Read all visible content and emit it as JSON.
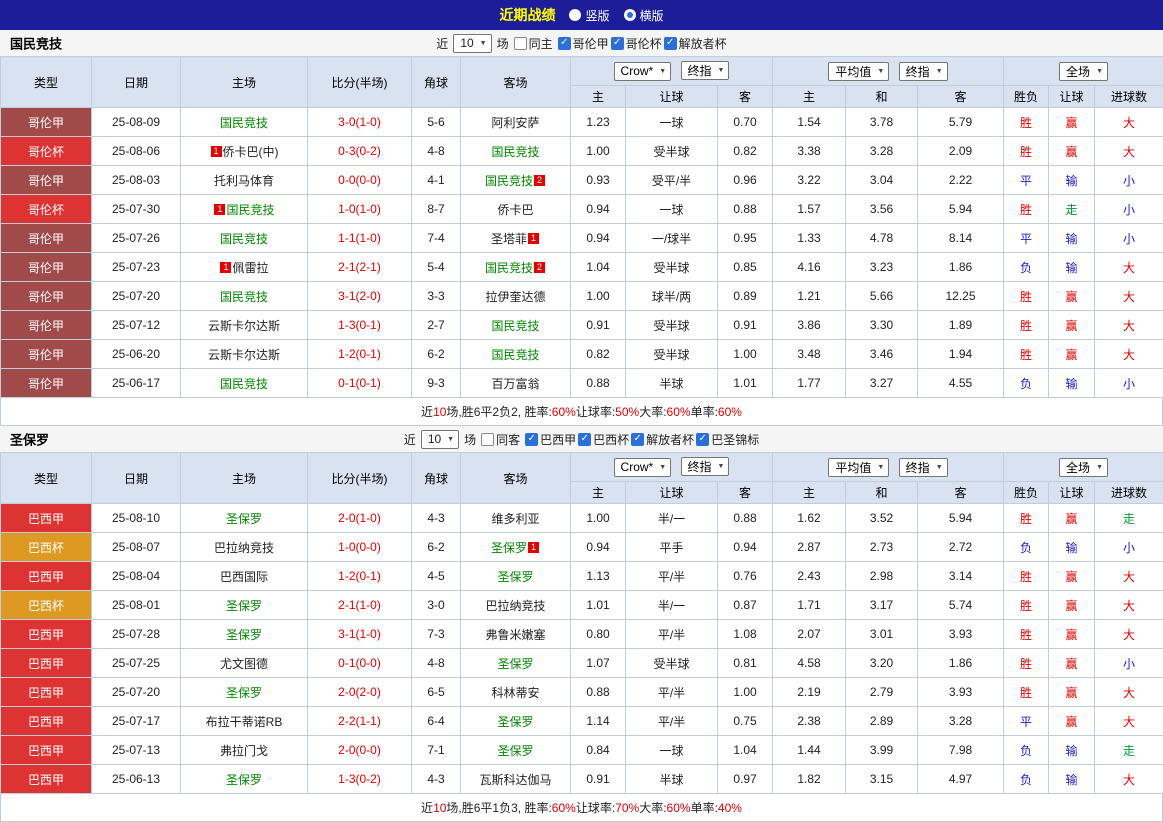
{
  "topbar": {
    "title": "近期战绩",
    "vertical_label": "竖版",
    "horizontal_label": "横版"
  },
  "filter_labels": {
    "near": "近",
    "games": "场"
  },
  "table_labels": {
    "type": "类型",
    "date": "日期",
    "home": "主场",
    "score": "比分(半场)",
    "corner": "角球",
    "away": "客场",
    "bookmaker": "Crow*",
    "final_index": "终指",
    "average": "平均值",
    "full_match": "全场",
    "h_home": "主",
    "h_handicap": "让球",
    "h_away": "客",
    "h_home2": "主",
    "h_draw": "和",
    "h_away2": "客",
    "h_result": "胜负",
    "h_handicap_result": "让球",
    "h_goals": "进球数"
  },
  "league_colors": {
    "哥伦甲": "#a14a4a",
    "哥伦杯": "#dd3333",
    "巴西甲": "#dd3333",
    "巴西杯": "#dd9922"
  },
  "result_colors": {
    "胜": "#e60000",
    "平": "#1a1acd",
    "负": "#1a1acd",
    "赢": "#e60000",
    "输": "#1a1acd",
    "走": "#009933",
    "大": "#e60000",
    "小": "#1a1acd"
  },
  "sections": [
    {
      "team": "国民竞技",
      "filter": {
        "count": "10",
        "same_label": "同主",
        "competitions": [
          "哥伦甲",
          "哥伦杯",
          "解放者杯"
        ]
      },
      "rows": [
        {
          "league": "哥伦甲",
          "date": "25-08-09",
          "home": {
            "text": "国民竞技",
            "self": true
          },
          "score": "3-0(1-0)",
          "corner": "5-6",
          "away": {
            "text": "阿利安萨"
          },
          "asian": [
            "1.23",
            "一球",
            "0.70"
          ],
          "euro": [
            "1.54",
            "3.78",
            "5.79"
          ],
          "results": [
            "胜",
            "赢",
            "大"
          ]
        },
        {
          "league": "哥伦杯",
          "date": "25-08-06",
          "home": {
            "text": "侨卡巴(中)",
            "pre": "1"
          },
          "score": "0-3(0-2)",
          "corner": "4-8",
          "away": {
            "text": "国民竞技",
            "self": true
          },
          "asian": [
            "1.00",
            "受半球",
            "0.82"
          ],
          "euro": [
            "3.38",
            "3.28",
            "2.09"
          ],
          "results": [
            "胜",
            "赢",
            "大"
          ]
        },
        {
          "league": "哥伦甲",
          "date": "25-08-03",
          "home": {
            "text": "托利马体育"
          },
          "score": "0-0(0-0)",
          "corner": "4-1",
          "away": {
            "text": "国民竞技",
            "self": true,
            "post": "2"
          },
          "asian": [
            "0.93",
            "受平/半",
            "0.96"
          ],
          "euro": [
            "3.22",
            "3.04",
            "2.22"
          ],
          "results": [
            "平",
            "输",
            "小"
          ]
        },
        {
          "league": "哥伦杯",
          "date": "25-07-30",
          "home": {
            "text": "国民竞技",
            "self": true,
            "pre": "1"
          },
          "score": "1-0(1-0)",
          "corner": "8-7",
          "away": {
            "text": "侨卡巴"
          },
          "asian": [
            "0.94",
            "一球",
            "0.88"
          ],
          "euro": [
            "1.57",
            "3.56",
            "5.94"
          ],
          "results": [
            "胜",
            "走",
            "小"
          ]
        },
        {
          "league": "哥伦甲",
          "date": "25-07-26",
          "home": {
            "text": "国民竞技",
            "self": true
          },
          "score": "1-1(1-0)",
          "corner": "7-4",
          "away": {
            "text": "圣塔菲",
            "post": "1"
          },
          "asian": [
            "0.94",
            "一/球半",
            "0.95"
          ],
          "euro": [
            "1.33",
            "4.78",
            "8.14"
          ],
          "results": [
            "平",
            "输",
            "小"
          ]
        },
        {
          "league": "哥伦甲",
          "date": "25-07-23",
          "home": {
            "text": "佩雷拉",
            "pre": "1"
          },
          "score": "2-1(2-1)",
          "corner": "5-4",
          "away": {
            "text": "国民竞技",
            "self": true,
            "post": "2"
          },
          "asian": [
            "1.04",
            "受半球",
            "0.85"
          ],
          "euro": [
            "4.16",
            "3.23",
            "1.86"
          ],
          "results": [
            "负",
            "输",
            "大"
          ]
        },
        {
          "league": "哥伦甲",
          "date": "25-07-20",
          "home": {
            "text": "国民竞技",
            "self": true
          },
          "score": "3-1(2-0)",
          "corner": "3-3",
          "away": {
            "text": "拉伊奎达德"
          },
          "asian": [
            "1.00",
            "球半/两",
            "0.89"
          ],
          "euro": [
            "1.21",
            "5.66",
            "12.25"
          ],
          "results": [
            "胜",
            "赢",
            "大"
          ]
        },
        {
          "league": "哥伦甲",
          "date": "25-07-12",
          "home": {
            "text": "云斯卡尔达斯"
          },
          "score": "1-3(0-1)",
          "corner": "2-7",
          "away": {
            "text": "国民竞技",
            "self": true
          },
          "asian": [
            "0.91",
            "受半球",
            "0.91"
          ],
          "euro": [
            "3.86",
            "3.30",
            "1.89"
          ],
          "results": [
            "胜",
            "赢",
            "大"
          ]
        },
        {
          "league": "哥伦甲",
          "date": "25-06-20",
          "home": {
            "text": "云斯卡尔达斯"
          },
          "score": "1-2(0-1)",
          "corner": "6-2",
          "away": {
            "text": "国民竞技",
            "self": true
          },
          "asian": [
            "0.82",
            "受半球",
            "1.00"
          ],
          "euro": [
            "3.48",
            "3.46",
            "1.94"
          ],
          "results": [
            "胜",
            "赢",
            "大"
          ]
        },
        {
          "league": "哥伦甲",
          "date": "25-06-17",
          "home": {
            "text": "国民竞技",
            "self": true
          },
          "score": "0-1(0-1)",
          "corner": "9-3",
          "away": {
            "text": "百万富翁"
          },
          "asian": [
            "0.88",
            "半球",
            "1.01"
          ],
          "euro": [
            "1.77",
            "3.27",
            "4.55"
          ],
          "results": [
            "负",
            "输",
            "小"
          ]
        }
      ],
      "summary": [
        {
          "t": "近"
        },
        {
          "t": "10",
          "red": true
        },
        {
          "t": "场,胜6平2负2, 胜率:"
        },
        {
          "t": "60%",
          "red": true
        },
        {
          "t": " 让球率:"
        },
        {
          "t": "50%",
          "red": true
        },
        {
          "t": " 大率:"
        },
        {
          "t": "60%",
          "red": true
        },
        {
          "t": " 单率:"
        },
        {
          "t": "60%",
          "red": true
        }
      ]
    },
    {
      "team": "圣保罗",
      "filter": {
        "count": "10",
        "same_label": "同客",
        "competitions": [
          "巴西甲",
          "巴西杯",
          "解放者杯",
          "巴圣锦标"
        ]
      },
      "rows": [
        {
          "league": "巴西甲",
          "date": "25-08-10",
          "home": {
            "text": "圣保罗",
            "self": true
          },
          "score": "2-0(1-0)",
          "corner": "4-3",
          "away": {
            "text": "维多利亚"
          },
          "asian": [
            "1.00",
            "半/一",
            "0.88"
          ],
          "euro": [
            "1.62",
            "3.52",
            "5.94"
          ],
          "results": [
            "胜",
            "赢",
            "走"
          ]
        },
        {
          "league": "巴西杯",
          "date": "25-08-07",
          "home": {
            "text": "巴拉纳竞技"
          },
          "score": "1-0(0-0)",
          "corner": "6-2",
          "away": {
            "text": "圣保罗",
            "self": true,
            "post": "1"
          },
          "asian": [
            "0.94",
            "平手",
            "0.94"
          ],
          "euro": [
            "2.87",
            "2.73",
            "2.72"
          ],
          "results": [
            "负",
            "输",
            "小"
          ]
        },
        {
          "league": "巴西甲",
          "date": "25-08-04",
          "home": {
            "text": "巴西国际"
          },
          "score": "1-2(0-1)",
          "corner": "4-5",
          "away": {
            "text": "圣保罗",
            "self": true
          },
          "asian": [
            "1.13",
            "平/半",
            "0.76"
          ],
          "euro": [
            "2.43",
            "2.98",
            "3.14"
          ],
          "results": [
            "胜",
            "赢",
            "大"
          ]
        },
        {
          "league": "巴西杯",
          "date": "25-08-01",
          "home": {
            "text": "圣保罗",
            "self": true
          },
          "score": "2-1(1-0)",
          "corner": "3-0",
          "away": {
            "text": "巴拉纳竞技"
          },
          "asian": [
            "1.01",
            "半/一",
            "0.87"
          ],
          "euro": [
            "1.71",
            "3.17",
            "5.74"
          ],
          "results": [
            "胜",
            "赢",
            "大"
          ]
        },
        {
          "league": "巴西甲",
          "date": "25-07-28",
          "home": {
            "text": "圣保罗",
            "self": true
          },
          "score": "3-1(1-0)",
          "corner": "7-3",
          "away": {
            "text": "弗鲁米嫩塞"
          },
          "asian": [
            "0.80",
            "平/半",
            "1.08"
          ],
          "euro": [
            "2.07",
            "3.01",
            "3.93"
          ],
          "results": [
            "胜",
            "赢",
            "大"
          ]
        },
        {
          "league": "巴西甲",
          "date": "25-07-25",
          "home": {
            "text": "尤文图德"
          },
          "score": "0-1(0-0)",
          "corner": "4-8",
          "away": {
            "text": "圣保罗",
            "self": true
          },
          "asian": [
            "1.07",
            "受半球",
            "0.81"
          ],
          "euro": [
            "4.58",
            "3.20",
            "1.86"
          ],
          "results": [
            "胜",
            "赢",
            "小"
          ]
        },
        {
          "league": "巴西甲",
          "date": "25-07-20",
          "home": {
            "text": "圣保罗",
            "self": true
          },
          "score": "2-0(2-0)",
          "corner": "6-5",
          "away": {
            "text": "科林蒂安"
          },
          "asian": [
            "0.88",
            "平/半",
            "1.00"
          ],
          "euro": [
            "2.19",
            "2.79",
            "3.93"
          ],
          "results": [
            "胜",
            "赢",
            "大"
          ]
        },
        {
          "league": "巴西甲",
          "date": "25-07-17",
          "home": {
            "text": "布拉干蒂诺RB"
          },
          "score": "2-2(1-1)",
          "corner": "6-4",
          "away": {
            "text": "圣保罗",
            "self": true
          },
          "asian": [
            "1.14",
            "平/半",
            "0.75"
          ],
          "euro": [
            "2.38",
            "2.89",
            "3.28"
          ],
          "results": [
            "平",
            "赢",
            "大"
          ]
        },
        {
          "league": "巴西甲",
          "date": "25-07-13",
          "home": {
            "text": "弗拉门戈"
          },
          "score": "2-0(0-0)",
          "corner": "7-1",
          "away": {
            "text": "圣保罗",
            "self": true
          },
          "asian": [
            "0.84",
            "一球",
            "1.04"
          ],
          "euro": [
            "1.44",
            "3.99",
            "7.98"
          ],
          "results": [
            "负",
            "输",
            "走"
          ]
        },
        {
          "league": "巴西甲",
          "date": "25-06-13",
          "home": {
            "text": "圣保罗",
            "self": true
          },
          "score": "1-3(0-2)",
          "corner": "4-3",
          "away": {
            "text": "瓦斯科达伽马"
          },
          "asian": [
            "0.91",
            "半球",
            "0.97"
          ],
          "euro": [
            "1.82",
            "3.15",
            "4.97"
          ],
          "results": [
            "负",
            "输",
            "大"
          ]
        }
      ],
      "summary": [
        {
          "t": "近"
        },
        {
          "t": "10",
          "red": true
        },
        {
          "t": "场,胜6平1负3, 胜率:"
        },
        {
          "t": "60%",
          "red": true
        },
        {
          "t": " 让球率:"
        },
        {
          "t": "70%",
          "red": true
        },
        {
          "t": " 大率:"
        },
        {
          "t": "60%",
          "red": true
        },
        {
          "t": " 单率:"
        },
        {
          "t": "40%",
          "red": true
        }
      ]
    }
  ]
}
